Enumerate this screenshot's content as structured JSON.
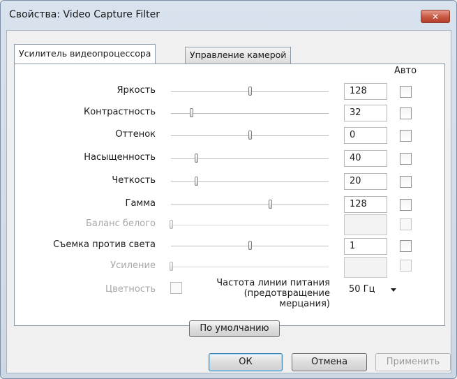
{
  "window": {
    "title": "Свойства: Video Capture Filter",
    "close_symbol": "✕"
  },
  "tabs": [
    {
      "label": "Усилитель видеопроцессора",
      "active": true
    },
    {
      "label": "Управление камерой",
      "active": false
    }
  ],
  "auto_header": "Авто",
  "rows": [
    {
      "label": "Яркость",
      "value": "128",
      "level": 0.5,
      "enabled": true
    },
    {
      "label": "Контрастность",
      "value": "32",
      "level": 0.13,
      "enabled": true
    },
    {
      "label": "Оттенок",
      "value": "0",
      "level": 0.5,
      "enabled": true
    },
    {
      "label": "Насыщенность",
      "value": "40",
      "level": 0.16,
      "enabled": true
    },
    {
      "label": "Четкость",
      "value": "20",
      "level": 0.16,
      "enabled": true
    },
    {
      "label": "Гамма",
      "value": "128",
      "level": 0.63,
      "enabled": true
    },
    {
      "label": "Баланс белого",
      "value": "",
      "level": 0.0,
      "enabled": false
    },
    {
      "label": "Съемка против света",
      "value": "1",
      "level": 0.5,
      "enabled": true
    },
    {
      "label": "Усиление",
      "value": "",
      "level": 0.0,
      "enabled": false
    }
  ],
  "color": {
    "label": "Цветность"
  },
  "power_line": {
    "label_lines": [
      "Частота линии питания",
      "(предотвращение",
      "мерцания)"
    ],
    "selected": "50 Гц"
  },
  "buttons": {
    "default_label": "По умолчанию",
    "ok_label": "ОК",
    "cancel_label": "Отмена",
    "apply_label": "Применить"
  }
}
